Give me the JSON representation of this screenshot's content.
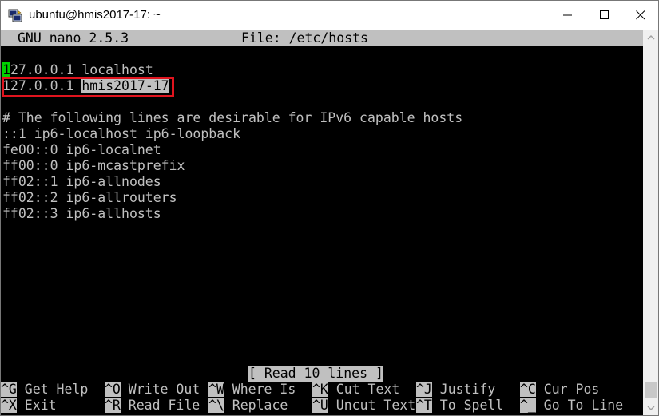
{
  "window": {
    "title": "ubuntu@hmis2017-17: ~",
    "icons": [
      "putty-app-icon",
      "minimize-icon",
      "maximize-icon",
      "close-icon"
    ]
  },
  "nano": {
    "header_left": "GNU nano 2.5.3",
    "header_file": "File: /etc/hosts",
    "lines": {
      "l1_cursor": "1",
      "l1_rest": "27.0.0.1 localhost",
      "l2_ip": "127.0.0.1 ",
      "l2_host": "hmis2017-17",
      "l4": "# The following lines are desirable for IPv6 capable hosts",
      "l5": "::1 ip6-localhost ip6-loopback",
      "l6": "fe00::0 ip6-localnet",
      "l7": "ff00::0 ip6-mcastprefix",
      "l8": "ff02::1 ip6-allnodes",
      "l9": "ff02::2 ip6-allrouters",
      "l10": "ff02::3 ip6-allhosts"
    },
    "status": "[ Read 10 lines ]",
    "shortcuts_row1": [
      {
        "key": "^G",
        "label": " Get Help  "
      },
      {
        "key": "^O",
        "label": " Write Out "
      },
      {
        "key": "^W",
        "label": " Where Is  "
      },
      {
        "key": "^K",
        "label": " Cut Text  "
      },
      {
        "key": "^J",
        "label": " Justify   "
      },
      {
        "key": "^C",
        "label": " Cur Pos"
      }
    ],
    "shortcuts_row2": [
      {
        "key": "^X",
        "label": " Exit      "
      },
      {
        "key": "^R",
        "label": " Read File "
      },
      {
        "key": "^\\",
        "label": " Replace   "
      },
      {
        "key": "^U",
        "label": " Uncut Text"
      },
      {
        "key": "^T",
        "label": " To Spell  "
      },
      {
        "key": "^_",
        "label": " Go To Line"
      }
    ]
  },
  "colors": {
    "terminal_bg": "#000000",
    "terminal_fg": "#c0c0c0",
    "cursor": "#00d000",
    "highlight_box": "#e0141e"
  }
}
